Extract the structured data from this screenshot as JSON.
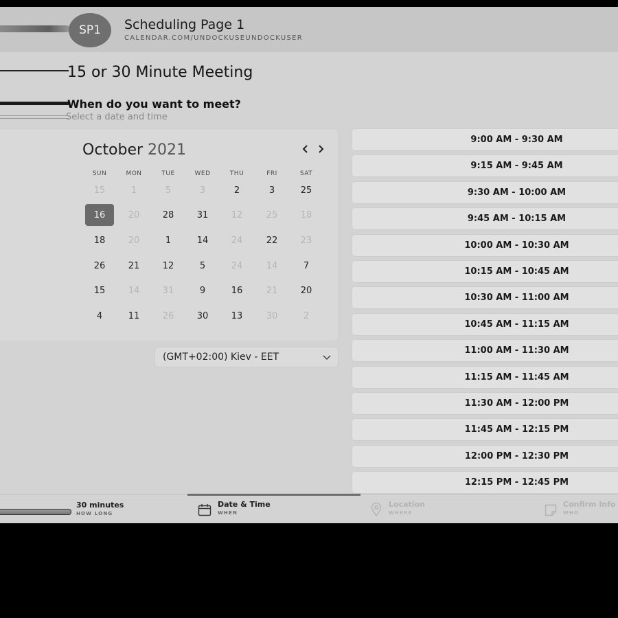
{
  "header": {
    "avatar": "SP1",
    "title": "Scheduling Page 1",
    "url": "CALENDAR.COM/UNDOCKUSEUNDOCKUSER"
  },
  "meeting_title": "15 or 30 Minute Meeting",
  "prompt": {
    "question": "When do you want to meet?",
    "hint": "Select a date and time"
  },
  "calendar": {
    "month": "October",
    "year": "2021",
    "prev_icon": "‹",
    "next_icon": "›",
    "weekdays": [
      "SUN",
      "MON",
      "TUE",
      "WED",
      "THU",
      "FRI",
      "SAT"
    ],
    "weeks": [
      [
        {
          "d": "15",
          "on": false
        },
        {
          "d": "1",
          "on": false
        },
        {
          "d": "5",
          "on": false
        },
        {
          "d": "3",
          "on": false
        },
        {
          "d": "2",
          "on": true
        },
        {
          "d": "3",
          "on": true
        },
        {
          "d": "25",
          "on": true
        }
      ],
      [
        {
          "d": "16",
          "on": true,
          "selected": true
        },
        {
          "d": "20",
          "on": false
        },
        {
          "d": "28",
          "on": true
        },
        {
          "d": "31",
          "on": true
        },
        {
          "d": "12",
          "on": false
        },
        {
          "d": "25",
          "on": false
        },
        {
          "d": "18",
          "on": false
        }
      ],
      [
        {
          "d": "18",
          "on": true
        },
        {
          "d": "20",
          "on": false
        },
        {
          "d": "1",
          "on": true
        },
        {
          "d": "14",
          "on": true
        },
        {
          "d": "24",
          "on": false
        },
        {
          "d": "22",
          "on": true
        },
        {
          "d": "23",
          "on": false
        }
      ],
      [
        {
          "d": "26",
          "on": true
        },
        {
          "d": "21",
          "on": true
        },
        {
          "d": "12",
          "on": true
        },
        {
          "d": "5",
          "on": true
        },
        {
          "d": "24",
          "on": false
        },
        {
          "d": "14",
          "on": false
        },
        {
          "d": "7",
          "on": true
        }
      ],
      [
        {
          "d": "15",
          "on": true
        },
        {
          "d": "14",
          "on": false
        },
        {
          "d": "31",
          "on": false
        },
        {
          "d": "9",
          "on": true
        },
        {
          "d": "16",
          "on": true
        },
        {
          "d": "21",
          "on": false
        },
        {
          "d": "20",
          "on": true
        }
      ],
      [
        {
          "d": "4",
          "on": true
        },
        {
          "d": "11",
          "on": true
        },
        {
          "d": "26",
          "on": false
        },
        {
          "d": "30",
          "on": true
        },
        {
          "d": "13",
          "on": true
        },
        {
          "d": "30",
          "on": false
        },
        {
          "d": "2",
          "on": false
        }
      ]
    ]
  },
  "timezone": {
    "value": "(GMT+02:00) Kiev - EET"
  },
  "time_slots": [
    "9:00 AM - 9:30 AM",
    "9:15 AM - 9:45 AM",
    "9:30 AM - 10:00 AM",
    "9:45 AM - 10:15 AM",
    "10:00 AM - 10:30 AM",
    "10:15 AM - 10:45 AM",
    "10:30 AM - 11:00 AM",
    "10:45 AM - 11:15 AM",
    "11:00 AM - 11:30 AM",
    "11:15 AM - 11:45 AM",
    "11:30 AM - 12:00 PM",
    "11:45 AM - 12:15 PM",
    "12:00 PM - 12:30 PM",
    "12:15 PM - 12:45 PM"
  ],
  "steps": [
    {
      "title": "30 minutes",
      "sub": "HOW LONG",
      "icon": "clock-icon",
      "active": false
    },
    {
      "title": "Date & Time",
      "sub": "WHEN",
      "icon": "calendar-icon",
      "active": true
    },
    {
      "title": "Location",
      "sub": "WHERE",
      "icon": "location-pin-icon",
      "active": false
    },
    {
      "title": "Confirm Info",
      "sub": "WHO",
      "icon": "note-icon",
      "active": false
    }
  ]
}
